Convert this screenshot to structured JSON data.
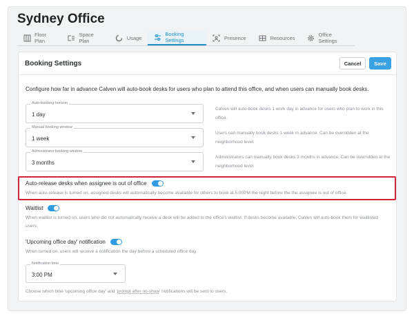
{
  "page": {
    "title": "Sydney Office"
  },
  "tabs": [
    {
      "label": "Floor Plan",
      "icon": "floor-plan-icon",
      "active": false
    },
    {
      "label": "Space Plan",
      "icon": "space-plan-icon",
      "active": false
    },
    {
      "label": "Usage",
      "icon": "usage-icon",
      "active": false
    },
    {
      "label": "Booking Settings",
      "icon": "sliders-icon",
      "active": true
    },
    {
      "label": "Presence",
      "icon": "presence-icon",
      "active": false
    },
    {
      "label": "Resources",
      "icon": "resources-icon",
      "active": false
    },
    {
      "label": "Office Settings",
      "icon": "gear-icon",
      "active": false
    }
  ],
  "card": {
    "title": "Booking Settings",
    "cancel_label": "Cancel",
    "save_label": "Save"
  },
  "intro": "Configure how far in advance Calven will auto-book desks for users who plan to attend this office, and when users can manually book desks.",
  "fields": [
    {
      "label": "Auto-booking horizon",
      "value": "1 day",
      "help": "Calven will auto-book desks 1 work day in advance for users who plan to work in this office."
    },
    {
      "label": "Manual booking window",
      "value": "1 week",
      "help": "Users can manually book desks 1 week in advance. Can be overridden at the neighborhood level."
    },
    {
      "label": "Administrator booking window",
      "value": "3 months",
      "help": "Administrators can manually book desks 3 months in advance. Can be overridden at the neighborhood level."
    }
  ],
  "auto_release": {
    "title": "Auto-release desks when assignee is out of office",
    "enabled": true,
    "desc": "When auto-release is turned on, assigned desks will automatically become available for others to book at 5:00PM the night before the the assignee is out of office."
  },
  "waitlist": {
    "title": "Waitlist",
    "enabled": true,
    "desc": "When waitlist is turned on, users who did not automatically receive a desk will be added to the office's waitlist. If desks become available, Calven will auto-book them for waitlisted users."
  },
  "notification": {
    "title": "'Upcoming office day' notification",
    "enabled": true,
    "desc": "When turned on, users will receive a notification the day before a scheduled office day.",
    "time_label": "Notification time",
    "time_value": "3:00 PM",
    "footer_pre": "Choose which time 'upcoming office day' and '",
    "footer_link": "prompt after no-show",
    "footer_post": "' notifications will be sent to users."
  },
  "colors": {
    "accent": "#3aa1e3",
    "highlight": "#d0233a",
    "active_tab": "#1d8fc9"
  }
}
